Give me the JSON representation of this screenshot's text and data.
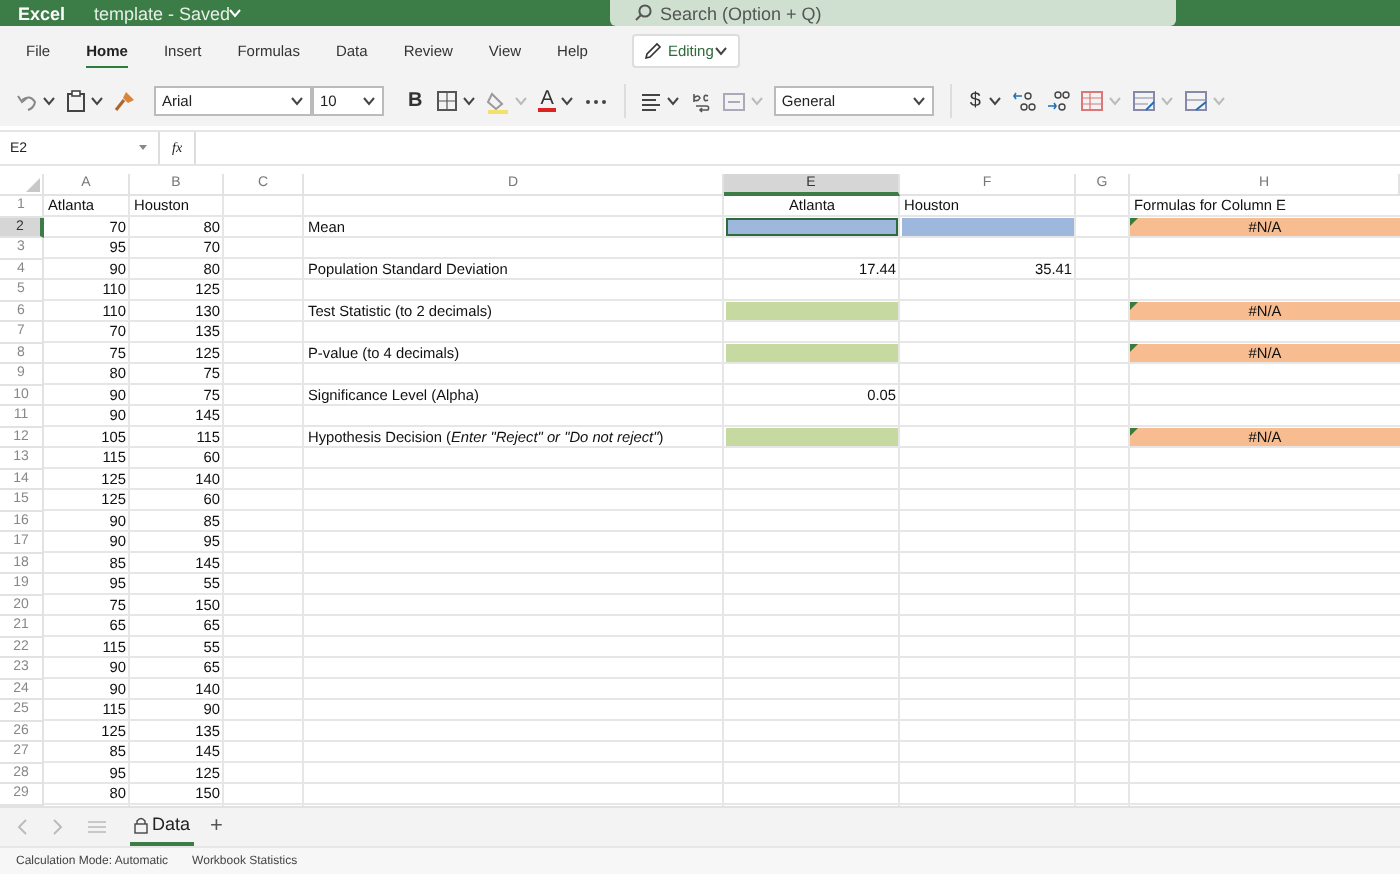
{
  "title_bar": {
    "app": "Excel",
    "document": "template - Saved",
    "search": {
      "placeholder": "Search (Option + Q)"
    }
  },
  "menu": [
    {
      "label": "File",
      "selected": false
    },
    {
      "label": "Home",
      "selected": true
    },
    {
      "label": "Insert",
      "selected": false
    },
    {
      "label": "Formulas",
      "selected": false
    },
    {
      "label": "Data",
      "selected": false
    },
    {
      "label": "Review",
      "selected": false
    },
    {
      "label": "View",
      "selected": false
    },
    {
      "label": "Help",
      "selected": false
    }
  ],
  "mode_button": {
    "label": "Editing"
  },
  "toolbar": {
    "font": "Arial",
    "size": "10",
    "bold": "B",
    "font_color": "A",
    "number_format": "General",
    "currency": "$"
  },
  "formula_bar": {
    "name_box": "E2",
    "fx": "fx"
  },
  "columns": [
    {
      "label": "A",
      "selected": false
    },
    {
      "label": "B",
      "selected": false
    },
    {
      "label": "C",
      "selected": false
    },
    {
      "label": "D",
      "selected": false
    },
    {
      "label": "E",
      "selected": true
    },
    {
      "label": "F",
      "selected": false
    },
    {
      "label": "G",
      "selected": false
    },
    {
      "label": "H",
      "selected": false
    }
  ],
  "rows": [
    {
      "label": "1",
      "selected": false,
      "cells": {
        "A": {
          "kind": "text",
          "text": "Atlanta"
        },
        "B": {
          "kind": "text",
          "text": "Houston"
        },
        "E": {
          "kind": "center",
          "text": "Atlanta"
        },
        "F": {
          "kind": "text",
          "text": "Houston"
        },
        "H": {
          "kind": "text",
          "text": "Formulas for Column E"
        }
      }
    },
    {
      "label": "2",
      "selected": true,
      "cells": {
        "A": "70",
        "B": "80",
        "D": {
          "kind": "text",
          "text": "Mean"
        },
        "E": {
          "kind": "fill",
          "color": "#9db8dc",
          "selected": true
        },
        "F": {
          "kind": "fill",
          "color": "#9db8dc",
          "selected": false
        },
        "H": {
          "kind": "error",
          "text": "#N/A",
          "color": "#f7bc8f"
        }
      }
    },
    {
      "label": "3",
      "selected": false,
      "cells": {
        "A": "95",
        "B": "70"
      }
    },
    {
      "label": "4",
      "selected": false,
      "cells": {
        "A": "90",
        "B": "80",
        "D": {
          "kind": "text",
          "text": "Population Standard Deviation"
        },
        "E": "17.44",
        "F": "35.41"
      }
    },
    {
      "label": "5",
      "selected": false,
      "cells": {
        "A": "110",
        "B": "125"
      }
    },
    {
      "label": "6",
      "selected": false,
      "cells": {
        "A": "110",
        "B": "130",
        "D": {
          "kind": "text",
          "text": "Test Statistic (to 2 decimals)"
        },
        "E": {
          "kind": "fill",
          "color": "#c5d9a0",
          "selected": false
        },
        "H": {
          "kind": "error",
          "text": "#N/A",
          "color": "#f7bc8f"
        }
      }
    },
    {
      "label": "7",
      "selected": false,
      "cells": {
        "A": "70",
        "B": "135"
      }
    },
    {
      "label": "8",
      "selected": false,
      "cells": {
        "A": "75",
        "B": "125",
        "D": {
          "kind": "text",
          "text": "P-value (to 4 decimals)"
        },
        "E": {
          "kind": "fill",
          "color": "#c5d9a0",
          "selected": false
        },
        "H": {
          "kind": "error",
          "text": "#N/A",
          "color": "#f7bc8f"
        }
      }
    },
    {
      "label": "9",
      "selected": false,
      "cells": {
        "A": "80",
        "B": "75"
      }
    },
    {
      "label": "10",
      "selected": false,
      "cells": {
        "A": "90",
        "B": "75",
        "D": {
          "kind": "text",
          "text": "Significance Level (Alpha)"
        },
        "E": "0.05"
      }
    },
    {
      "label": "11",
      "selected": false,
      "cells": {
        "A": "90",
        "B": "145"
      }
    },
    {
      "label": "12",
      "selected": false,
      "cells": {
        "A": "105",
        "B": "115",
        "D": {
          "kind": "text",
          "text": "Hypothesis Decision (*Enter \"Reject\" or \"Do not reject\"*)"
        },
        "E": {
          "kind": "fill",
          "color": "#c5d9a0",
          "selected": false
        },
        "H": {
          "kind": "error",
          "text": "#N/A",
          "color": "#f7bc8f"
        }
      }
    },
    {
      "label": "13",
      "selected": false,
      "cells": {
        "A": "115",
        "B": "60"
      }
    },
    {
      "label": "14",
      "selected": false,
      "cells": {
        "A": "125",
        "B": "140"
      }
    },
    {
      "label": "15",
      "selected": false,
      "cells": {
        "A": "125",
        "B": "60"
      }
    },
    {
      "label": "16",
      "selected": false,
      "cells": {
        "A": "90",
        "B": "85"
      }
    },
    {
      "label": "17",
      "selected": false,
      "cells": {
        "A": "90",
        "B": "95"
      }
    },
    {
      "label": "18",
      "selected": false,
      "cells": {
        "A": "85",
        "B": "145"
      }
    },
    {
      "label": "19",
      "selected": false,
      "cells": {
        "A": "95",
        "B": "55"
      }
    },
    {
      "label": "20",
      "selected": false,
      "cells": {
        "A": "75",
        "B": "150"
      }
    },
    {
      "label": "21",
      "selected": false,
      "cells": {
        "A": "65",
        "B": "65"
      }
    },
    {
      "label": "22",
      "selected": false,
      "cells": {
        "A": "115",
        "B": "55"
      }
    },
    {
      "label": "23",
      "selected": false,
      "cells": {
        "A": "90",
        "B": "65"
      }
    },
    {
      "label": "24",
      "selected": false,
      "cells": {
        "A": "90",
        "B": "140"
      }
    },
    {
      "label": "25",
      "selected": false,
      "cells": {
        "A": "115",
        "B": "90"
      }
    },
    {
      "label": "26",
      "selected": false,
      "cells": {
        "A": "125",
        "B": "135"
      }
    },
    {
      "label": "27",
      "selected": false,
      "cells": {
        "A": "85",
        "B": "145"
      }
    },
    {
      "label": "28",
      "selected": false,
      "cells": {
        "A": "95",
        "B": "125"
      }
    },
    {
      "label": "29",
      "selected": false,
      "cells": {
        "A": "80",
        "B": "150"
      }
    }
  ],
  "sheet_tabs": [
    {
      "label": "Data",
      "selected": true,
      "locked": true
    }
  ],
  "add_sheet": "+",
  "status_bar": [
    "Calculation Mode: Automatic",
    "Workbook Statistics"
  ]
}
